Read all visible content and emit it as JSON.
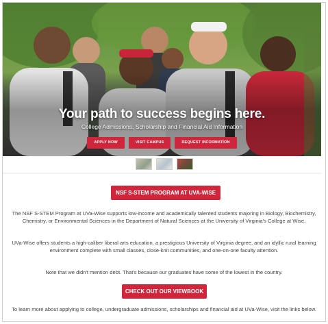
{
  "hero": {
    "title": "Your path to success begins here.",
    "subtitle": "College Admissions, Scholarship and Financial Aid Information",
    "buttons": [
      "APPLY NOW",
      "VISIT CAMPUS",
      "REQUEST INFORMATION"
    ]
  },
  "gallery": {
    "thumbnails": [
      "thumbnail-1",
      "thumbnail-2",
      "thumbnail-3"
    ]
  },
  "program": {
    "button_label": "NSF S-STEM PROGRAM AT UVA-WISE",
    "paragraph_1": "The NSF S-STEM Program at UVa-Wise supports low-income and academically talented students majoring in Biology, Biochemistry, Chemistry, or Environmental Sciences in the Department of Natural Sciences at the University of Virginia's College at Wise.",
    "paragraph_2": "UVa-Wise offers students a high-caliber liberal arts education, a prestigious University of Virginia degree, and an idyllic rural learning environment complete with small classes, close-knit communities, and one-on-one faculty attention.",
    "paragraph_3": "Note that we didn't mention debt. That's because our graduates have some of the lowest in the country."
  },
  "viewbook": {
    "button_label": "CHECK OUT OUR VIEWBOOK"
  },
  "footer_text": "To learn more about applying to college, undergraduate admissions, scholarships and financial aid at UVa-Wise, visit the links below.",
  "colors": {
    "accent": "#d0263c",
    "text": "#444444",
    "background": "#ffffff"
  }
}
